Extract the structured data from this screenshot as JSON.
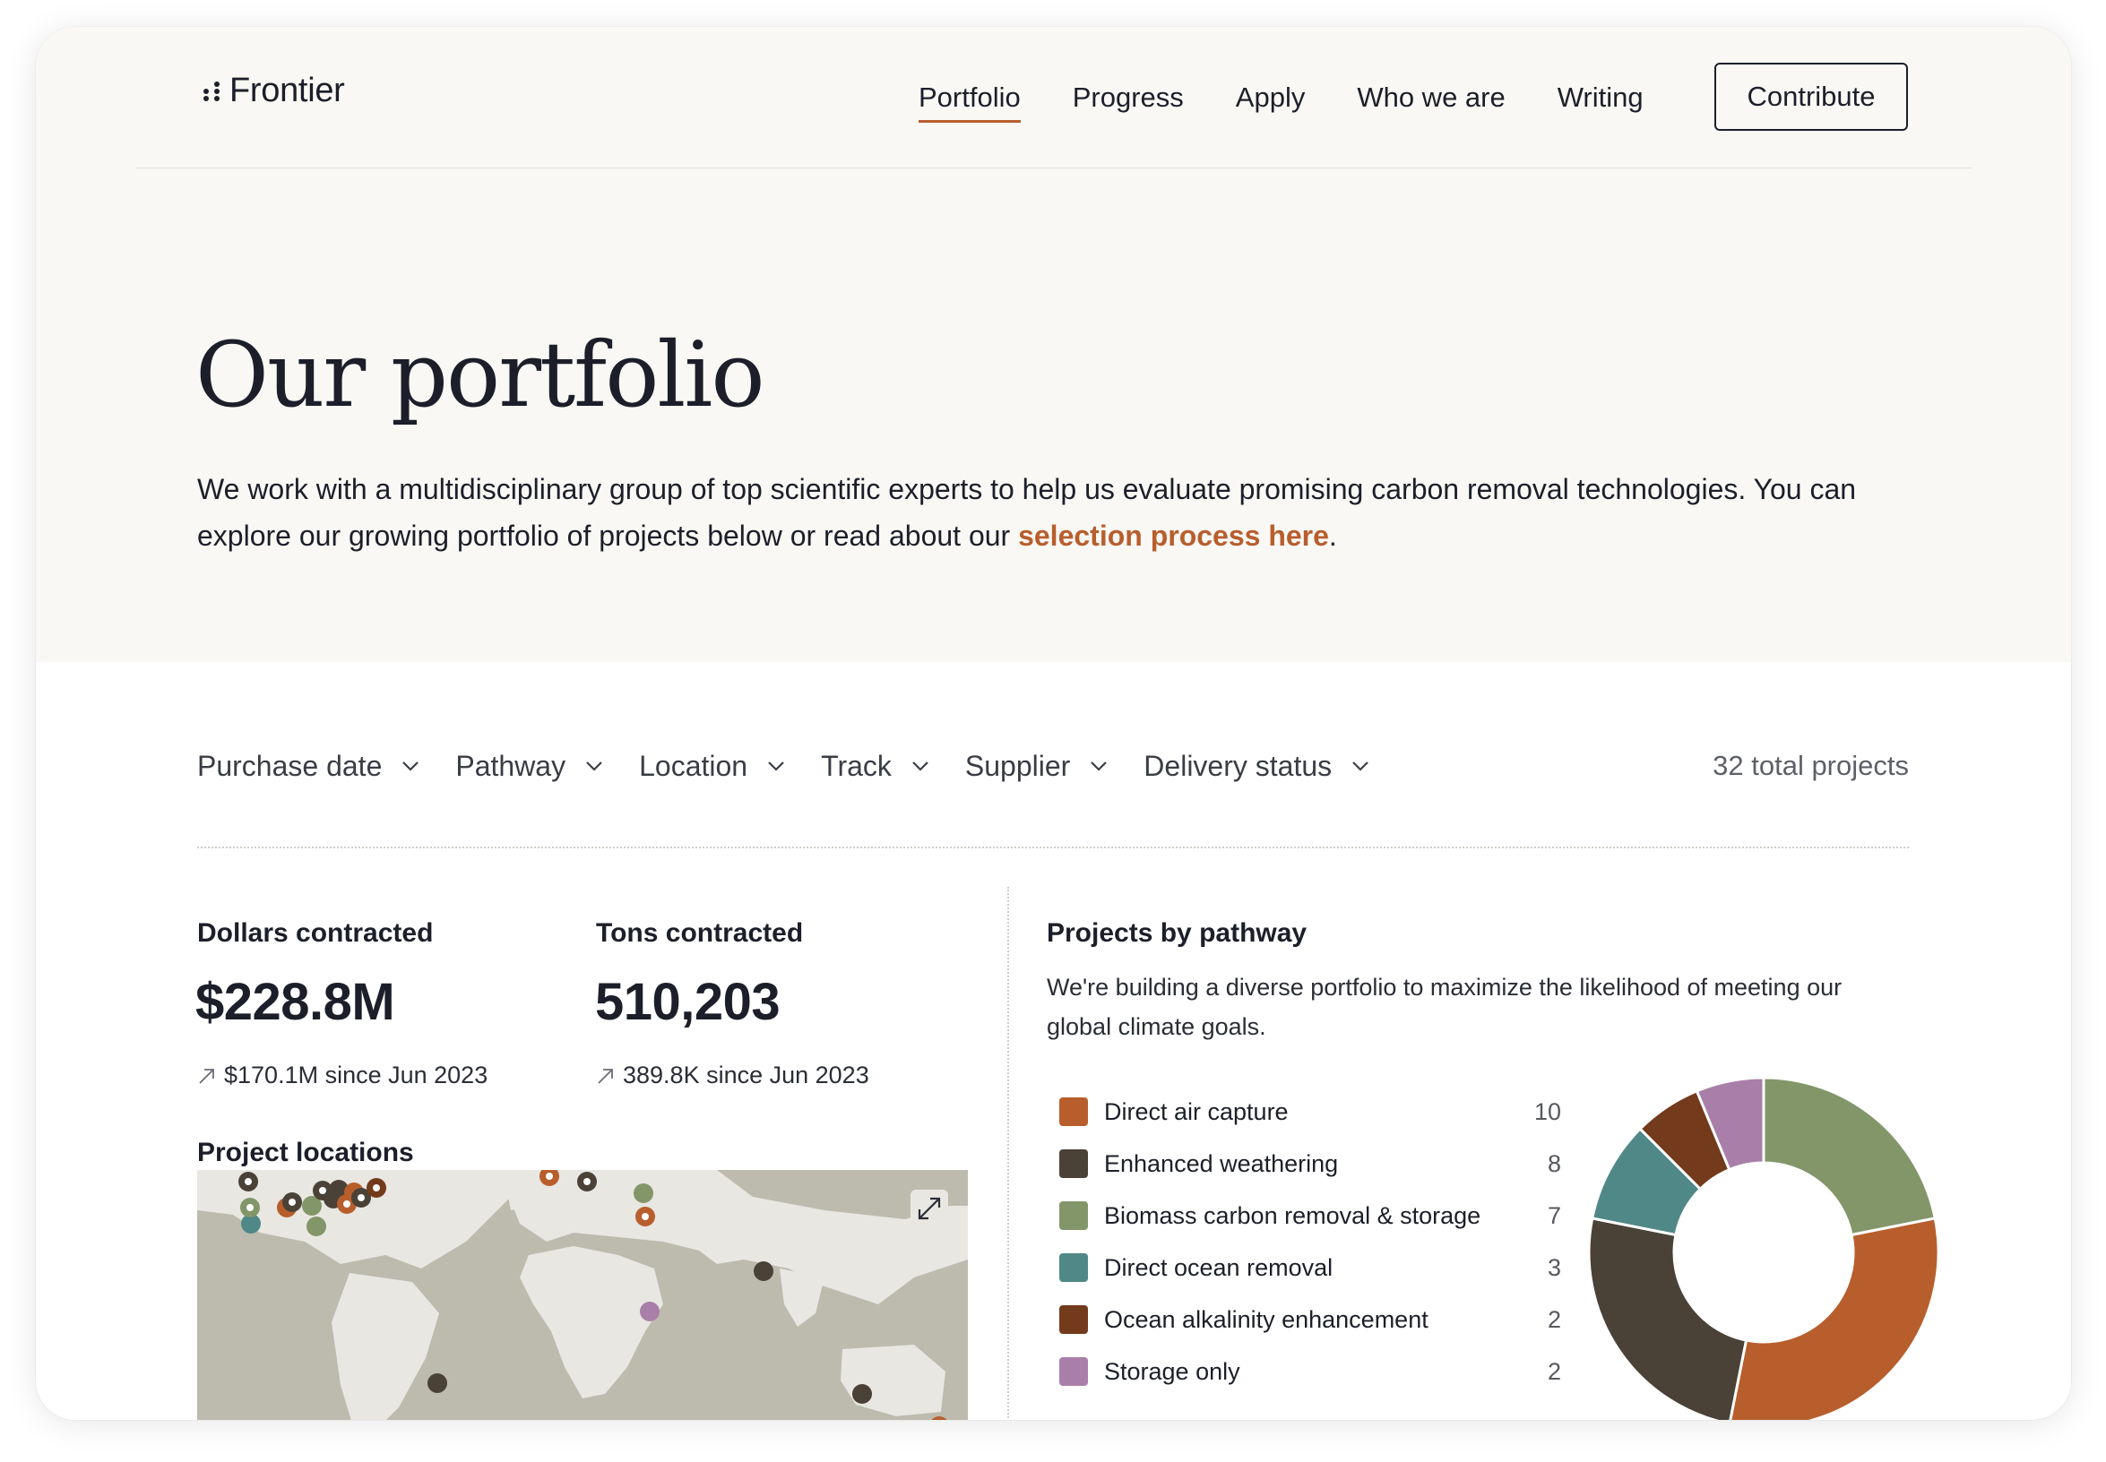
{
  "header": {
    "brand": "Frontier",
    "nav": [
      "Portfolio",
      "Progress",
      "Apply",
      "Who we are",
      "Writing"
    ],
    "active_nav": "Portfolio",
    "cta": "Contribute"
  },
  "hero": {
    "title": "Our portfolio",
    "intro_before": "We work with a multidisciplinary group of top scientific experts to help us evaluate promising carbon removal technologies. You can explore our growing portfolio of projects below or read about our ",
    "intro_link": "selection process here",
    "intro_after": "."
  },
  "filters": {
    "items": [
      "Purchase date",
      "Pathway",
      "Location",
      "Track",
      "Supplier",
      "Delivery status"
    ],
    "total": "32 total projects"
  },
  "stats": {
    "dollars_label": "Dollars contracted",
    "dollars_value": "$228.8M",
    "dollars_delta": "$170.1M since Jun 2023",
    "tons_label": "Tons contracted",
    "tons_value": "510,203",
    "tons_delta": "389.8K since Jun 2023"
  },
  "map": {
    "title": "Project locations",
    "expand_icon": "expand-icon"
  },
  "pathway": {
    "title": "Projects by pathway",
    "description": "We're building a diverse portfolio to maximize the likelihood of meeting our global climate goals."
  },
  "chart_data": {
    "type": "pie",
    "title": "Projects by pathway",
    "donut": true,
    "categories": [
      "Direct air capture",
      "Enhanced weathering",
      "Biomass carbon removal & storage",
      "Direct ocean removal",
      "Ocean alkalinity enhancement",
      "Storage only"
    ],
    "values": [
      10,
      8,
      7,
      3,
      2,
      2
    ],
    "colors": [
      "#b85e2d",
      "#4a4137",
      "#83966a",
      "#508887",
      "#733a1c",
      "#a97fa9"
    ],
    "slice_order": [
      2,
      0,
      1,
      3,
      4,
      5
    ],
    "legend": "left"
  },
  "colors": {
    "accent": "#b85e2d",
    "hero_bg": "#f9f8f4",
    "text": "#1c1f2a"
  }
}
